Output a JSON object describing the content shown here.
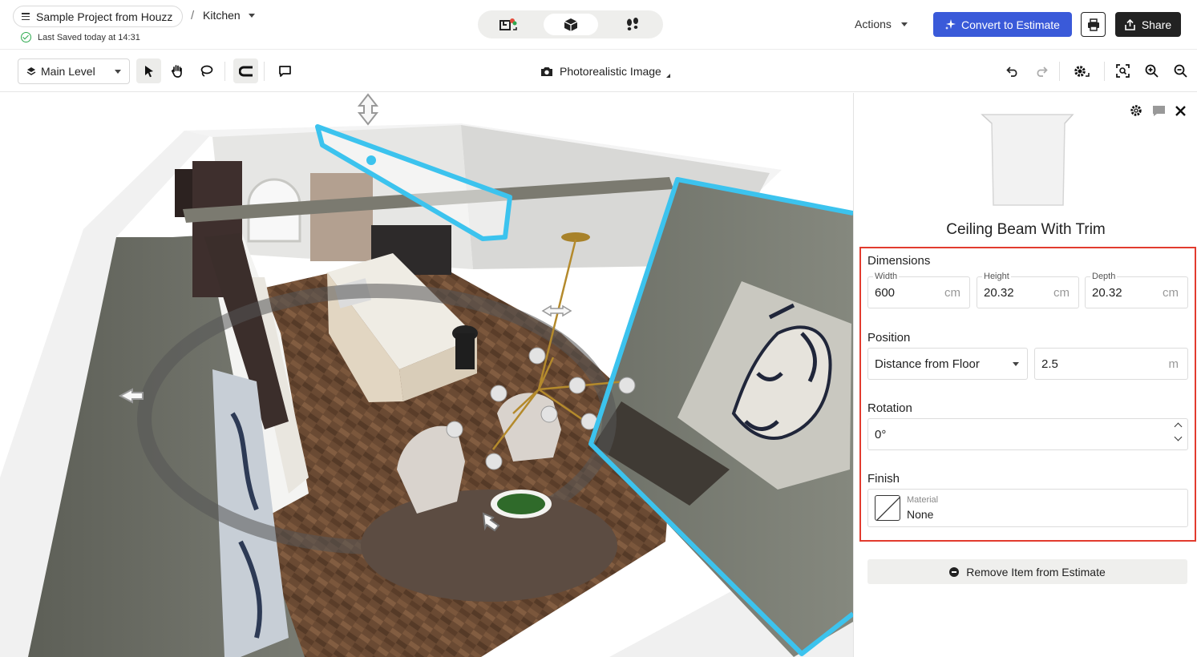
{
  "header": {
    "project_name": "Sample Project from Houzz",
    "breadcrumb_separator": "/",
    "room_name": "Kitchen",
    "saved_status": "Last Saved today at 14:31",
    "actions_label": "Actions",
    "convert_label": "Convert to Estimate",
    "share_label": "Share",
    "view_modes": [
      "2d-floorplan-icon",
      "3d-box-icon",
      "walkthrough-footsteps-icon"
    ],
    "active_view": "3d-box-icon"
  },
  "toolbar": {
    "level_label": "Main Level",
    "tools": [
      "select-arrow-icon",
      "pan-hand-icon",
      "lasso-icon",
      "snap-magnet-icon",
      "comment-icon"
    ],
    "photo_label": "Photorealistic Image",
    "right_tools": [
      "undo-icon",
      "redo-icon",
      "settings-gear-icon",
      "fit-view-icon",
      "zoom-in-icon",
      "zoom-out-icon"
    ]
  },
  "panel": {
    "item_title": "Ceiling Beam With Trim",
    "dimensions": {
      "section_label": "Dimensions",
      "width_label": "Width",
      "width_value": "600",
      "width_unit": "cm",
      "height_label": "Height",
      "height_value": "20.32",
      "height_unit": "cm",
      "depth_label": "Depth",
      "depth_value": "20.32",
      "depth_unit": "cm"
    },
    "position": {
      "section_label": "Position",
      "reference_option": "Distance from Floor",
      "value": "2.5",
      "unit": "m"
    },
    "rotation": {
      "section_label": "Rotation",
      "value": "0°"
    },
    "finish": {
      "section_label": "Finish",
      "material_label": "Material",
      "material_value": "None"
    },
    "remove_label": "Remove Item from Estimate"
  },
  "colors": {
    "convert_button": "#3a5ad9",
    "share_button": "#222222",
    "selection_outline": "#3cc3ee",
    "highlight_box": "#e23b2e",
    "saved_check": "#2eaa4f"
  }
}
